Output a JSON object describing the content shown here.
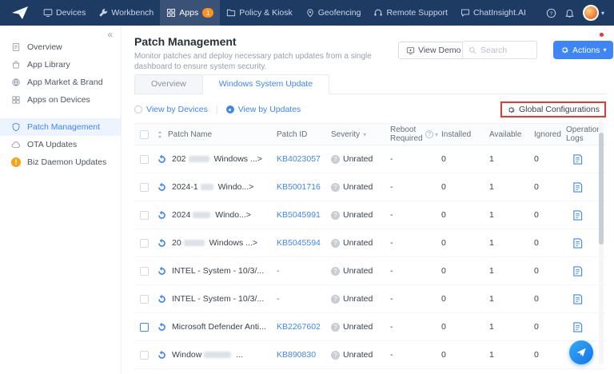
{
  "colors": {
    "accent": "#3e86f5",
    "topbar": "#1e3b63",
    "badge": "#ff8f1f",
    "annotation": "#e8382f"
  },
  "topnav": {
    "items": [
      {
        "label": "Devices",
        "icon": "devices"
      },
      {
        "label": "Workbench",
        "icon": "workbench"
      },
      {
        "label": "Apps",
        "icon": "apps",
        "badge": "1",
        "active": true
      },
      {
        "label": "Policy & Kiosk",
        "icon": "policy"
      },
      {
        "label": "Geofencing",
        "icon": "geofencing"
      },
      {
        "label": "Remote Support",
        "icon": "remote"
      },
      {
        "label": "ChatInsight.AI",
        "icon": "chat"
      }
    ]
  },
  "sidebar": {
    "collapse_icon": "«",
    "items": [
      {
        "label": "Overview",
        "icon": "overview"
      },
      {
        "label": "App Library",
        "icon": "library"
      },
      {
        "label": "App Market & Brand",
        "icon": "market"
      },
      {
        "label": "Apps on Devices",
        "icon": "devapps"
      },
      {
        "label": "Patch Management",
        "icon": "patch",
        "active": true,
        "gap": true
      },
      {
        "label": "OTA Updates",
        "icon": "ota"
      },
      {
        "label": "Biz Daemon Updates",
        "icon": "warning"
      }
    ]
  },
  "header": {
    "title": "Patch Management",
    "subtitle": "Monitor patches and deploy necessary patch updates from a single dashboard to ensure system security.",
    "view_demo_label": "View Demo",
    "search_placeholder": "Search",
    "actions_label": "Actions"
  },
  "tabs": [
    {
      "label": "Overview"
    },
    {
      "label": "Windows System Update",
      "active": true
    }
  ],
  "toolbar": {
    "view_by_devices": "View by Devices",
    "view_by_updates": "View by Updates",
    "divider": "|",
    "global_configurations": "Global Configurations"
  },
  "table": {
    "headers": {
      "name": "Patch Name",
      "id": "Patch ID",
      "severity": "Severity",
      "reboot": "Reboot Required",
      "installed": "Installed",
      "available": "Available",
      "ignored": "Ignored",
      "logs": "Operation Logs"
    },
    "rows": [
      {
        "parts": [
          {
            "t": "202"
          },
          {
            "r": 26
          },
          {
            "t": " Windows ...>"
          }
        ],
        "patch_id": "KB4023057",
        "severity": "Unrated",
        "reboot": "-",
        "installed": "0",
        "available": "1",
        "ignored": "0",
        "checkbox_highlight": false
      },
      {
        "parts": [
          {
            "t": "2024-1"
          },
          {
            "r": 16
          },
          {
            "t": " Windo...>"
          }
        ],
        "patch_id": "KB5001716",
        "severity": "Unrated",
        "reboot": "-",
        "installed": "0",
        "available": "1",
        "ignored": "0",
        "checkbox_highlight": false
      },
      {
        "parts": [
          {
            "t": "2024"
          },
          {
            "r": 22
          },
          {
            "t": " Windo...>"
          }
        ],
        "patch_id": "KB5045991",
        "severity": "Unrated",
        "reboot": "-",
        "installed": "0",
        "available": "1",
        "ignored": "0",
        "checkbox_highlight": false
      },
      {
        "parts": [
          {
            "t": "20"
          },
          {
            "r": 26
          },
          {
            "t": " Windows ...>"
          }
        ],
        "patch_id": "KB5045594",
        "severity": "Unrated",
        "reboot": "-",
        "installed": "0",
        "available": "1",
        "ignored": "0",
        "checkbox_highlight": false
      },
      {
        "parts": [
          {
            "t": "INTEL - System - 10/3/..."
          }
        ],
        "patch_id": "-",
        "severity": "Unrated",
        "reboot": "-",
        "installed": "0",
        "available": "1",
        "ignored": "0",
        "checkbox_highlight": false
      },
      {
        "parts": [
          {
            "t": "INTEL - System - 10/3/..."
          }
        ],
        "patch_id": "-",
        "severity": "Unrated",
        "reboot": "-",
        "installed": "0",
        "available": "1",
        "ignored": "0",
        "checkbox_highlight": false
      },
      {
        "parts": [
          {
            "t": "Microsoft Defender Anti..."
          }
        ],
        "patch_id": "KB2267602",
        "severity": "Unrated",
        "reboot": "-",
        "installed": "0",
        "available": "1",
        "ignored": "0",
        "checkbox_highlight": true
      },
      {
        "parts": [
          {
            "t": "Window"
          },
          {
            "r": 34
          },
          {
            "t": " ..."
          }
        ],
        "patch_id": "KB890830",
        "severity": "Unrated",
        "reboot": "-",
        "installed": "0",
        "available": "1",
        "ignored": "0",
        "checkbox_highlight": false
      }
    ]
  }
}
